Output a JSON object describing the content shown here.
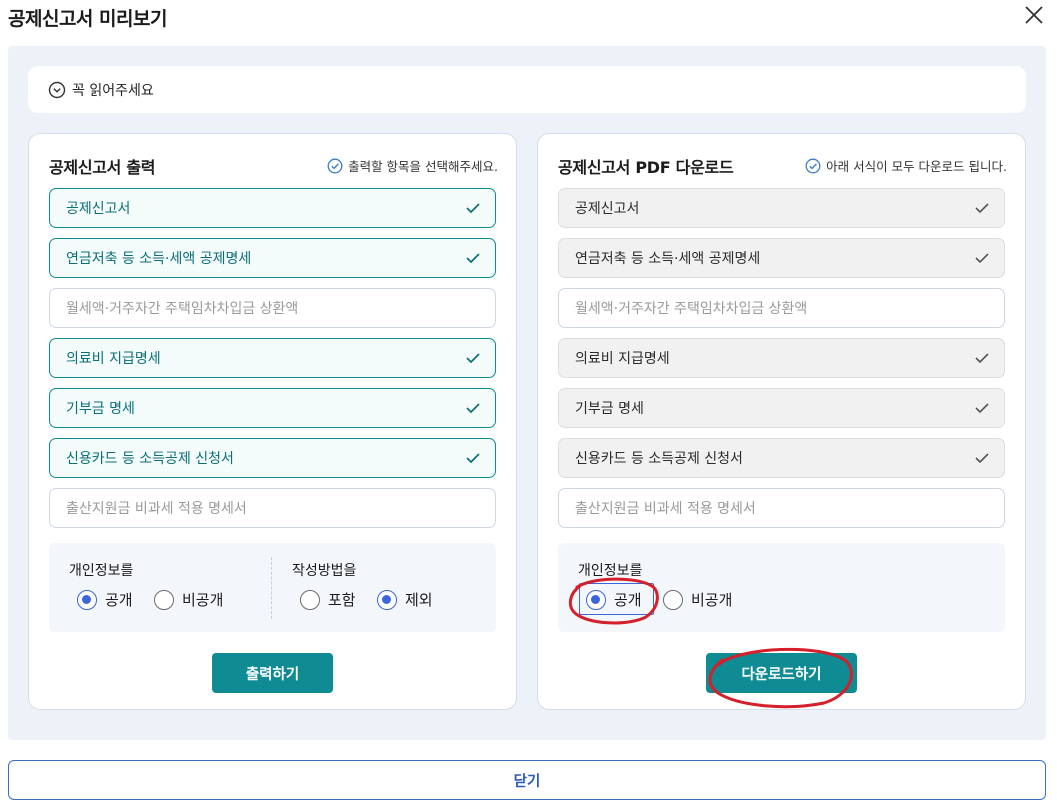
{
  "window": {
    "title": "공제신고서 미리보기"
  },
  "notice": {
    "label": "꼭 읽어주세요"
  },
  "print_panel": {
    "title": "공제신고서 출력",
    "hint": "출력할 항목을 선택해주세요.",
    "items": [
      {
        "label": "공제신고서",
        "checked": true
      },
      {
        "label": "연금저축 등 소득·세액 공제명세",
        "checked": true
      },
      {
        "label": "월세액·거주자간 주택임차차입금 상환액",
        "checked": false
      },
      {
        "label": "의료비 지급명세",
        "checked": true
      },
      {
        "label": "기부금 명세",
        "checked": true
      },
      {
        "label": "신용카드 등 소득공제 신청서",
        "checked": true
      },
      {
        "label": "출산지원금 비과세 적용 명세서",
        "checked": false
      }
    ],
    "privacy": {
      "label": "개인정보를",
      "options": [
        "공개",
        "비공개"
      ],
      "selected": "공개"
    },
    "method": {
      "label": "작성방법을",
      "options": [
        "포함",
        "제외"
      ],
      "selected": "제외"
    },
    "button": "출력하기"
  },
  "download_panel": {
    "title": "공제신고서 PDF 다운로드",
    "hint": "아래 서식이 모두 다운로드 됩니다.",
    "items": [
      {
        "label": "공제신고서",
        "included": true
      },
      {
        "label": "연금저축 등 소득·세액 공제명세",
        "included": true
      },
      {
        "label": "월세액·거주자간 주택임차차입금 상환액",
        "included": false
      },
      {
        "label": "의료비 지급명세",
        "included": true
      },
      {
        "label": "기부금 명세",
        "included": true
      },
      {
        "label": "신용카드 등 소득공제 신청서",
        "included": true
      },
      {
        "label": "출산지원금 비과세 적용 명세서",
        "included": false
      }
    ],
    "privacy": {
      "label": "개인정보를",
      "options": [
        "공개",
        "비공개"
      ],
      "selected": "공개"
    },
    "button": "다운로드하기"
  },
  "footer": {
    "close_label": "닫기"
  },
  "colors": {
    "accent": "#0e8b93",
    "radio": "#3a66d8",
    "annotation": "#d4202a",
    "close_border": "#3b6ec8"
  }
}
